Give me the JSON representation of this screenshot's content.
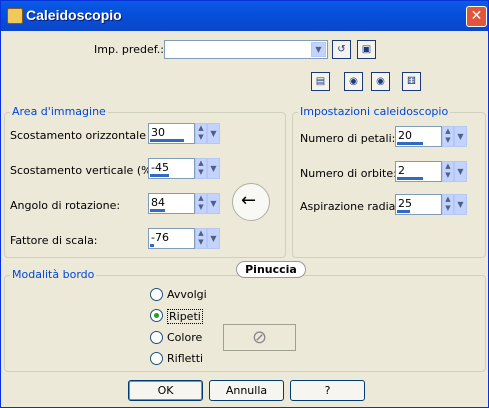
{
  "window": {
    "title": "Caleidoscopio",
    "close_label": "✕"
  },
  "preset": {
    "label": "Imp. predef.:",
    "value": ""
  },
  "area_immagine": {
    "legend": "Area d'immagine",
    "fields": [
      {
        "label": "Scostamento orizzontale (%):",
        "value": "30",
        "fill": 0.8
      },
      {
        "label": "Scostamento verticale (%):",
        "value": "-45",
        "fill": 0.45
      },
      {
        "label": "Angolo di rotazione:",
        "value": "84",
        "fill": 0.35
      },
      {
        "label": "Fattore di scala:",
        "value": "-76",
        "fill": 0.1
      }
    ]
  },
  "impostazioni": {
    "legend": "Impostazioni caleidoscopio",
    "fields": [
      {
        "label": "Numero di petali:",
        "value": "20",
        "fill": 0.6
      },
      {
        "label": "Numero di orbite:",
        "value": "2",
        "fill": 0.6
      },
      {
        "label": "Aspirazione radiale:",
        "value": "25",
        "fill": 0.3
      }
    ]
  },
  "modalita_bordo": {
    "legend": "Modalità bordo",
    "options": [
      {
        "label": "Avvolgi",
        "selected": false
      },
      {
        "label": "Ripeti",
        "selected": true
      },
      {
        "label": "Colore",
        "selected": false
      },
      {
        "label": "Rifletti",
        "selected": false
      }
    ]
  },
  "watermark": "Pinuccia",
  "buttons": {
    "ok": "OK",
    "cancel": "Annulla",
    "help": "?"
  },
  "icons": {
    "dial_arrow": "←",
    "no_color": "⊘"
  },
  "colors": {
    "titlebar": "#0650dc",
    "accent": "#316ac5",
    "legend_text": "#0046d5",
    "dialog_bg": "#ece9d8"
  }
}
